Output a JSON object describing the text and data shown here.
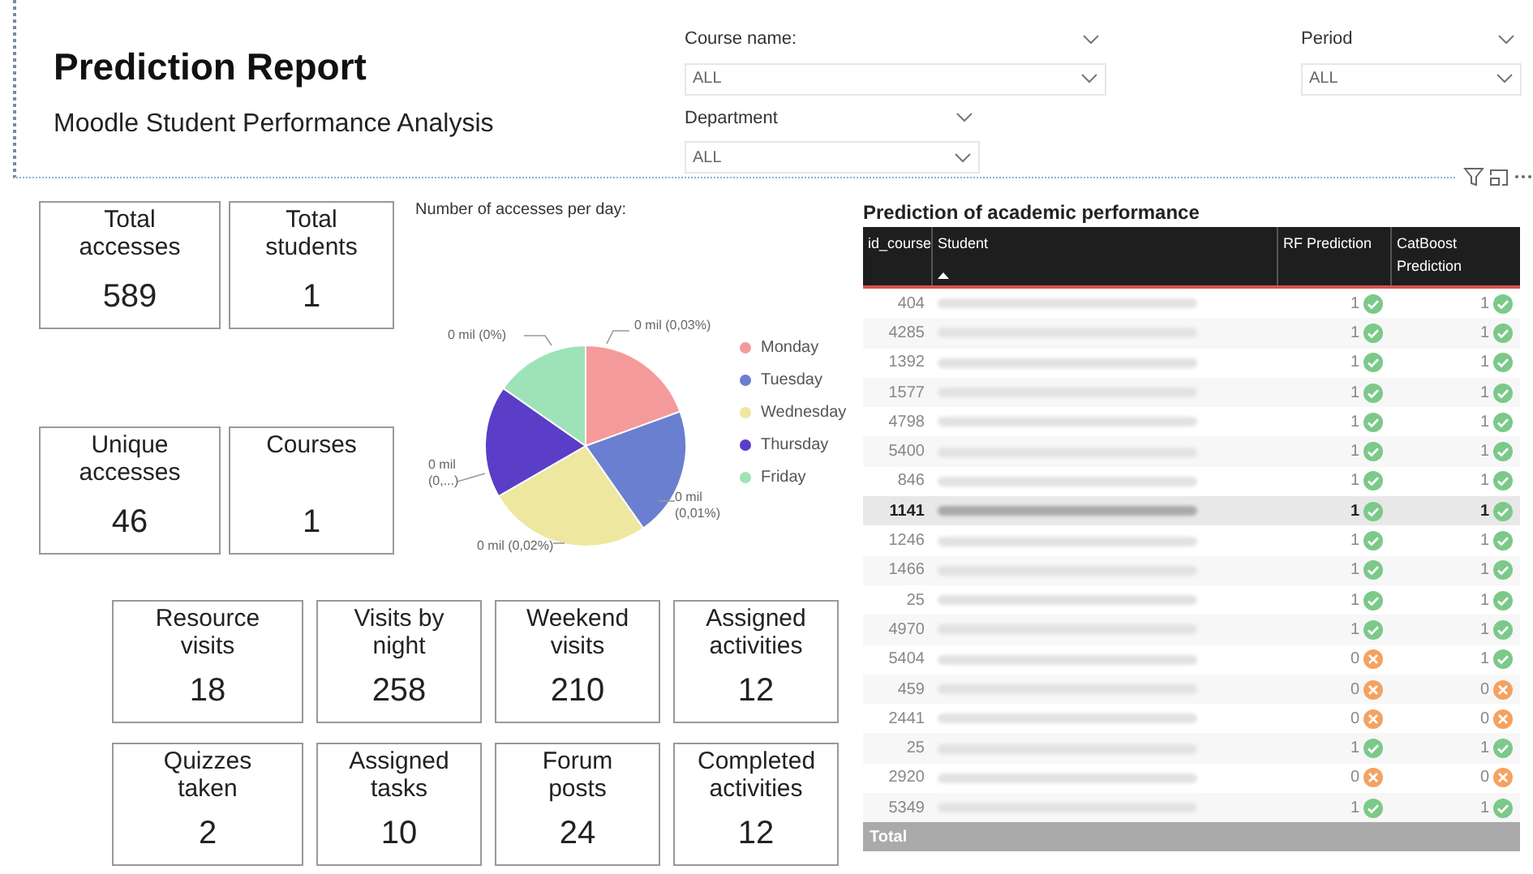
{
  "header": {
    "title": "Prediction Report",
    "subtitle": "Moodle Student Performance Analysis"
  },
  "filters": [
    {
      "label": "Course name:",
      "value": "ALL"
    },
    {
      "label": "Department",
      "value": "ALL"
    },
    {
      "label": "Period",
      "value": "ALL"
    }
  ],
  "kpis_top": [
    {
      "label": "Total accesses",
      "value": "589"
    },
    {
      "label": "Total students",
      "value": "1"
    },
    {
      "label": "Unique accesses",
      "value": "46"
    },
    {
      "label": "Courses",
      "value": "1"
    }
  ],
  "pie": {
    "title": "Number of accesses per day:",
    "legend": [
      {
        "label": "Monday",
        "color": "#f59a9a"
      },
      {
        "label": "Tuesday",
        "color": "#6b7fd0"
      },
      {
        "label": "Wednesday",
        "color": "#ede7a0"
      },
      {
        "label": "Thursday",
        "color": "#5a3ec8"
      },
      {
        "label": "Friday",
        "color": "#9ee3b8"
      }
    ],
    "slice_labels": [
      "0 mil (0,03%)",
      "0 mil (0,01%)",
      "0 mil (0,02%)",
      "0 mil (0,...)",
      "0 mil (0%)"
    ]
  },
  "kpis_bottom": [
    {
      "label": "Resource visits",
      "value": "18"
    },
    {
      "label": "Visits by night",
      "value": "258"
    },
    {
      "label": "Weekend visits",
      "value": "210"
    },
    {
      "label": "Assigned activities",
      "value": "12"
    },
    {
      "label": "Quizzes taken",
      "value": "2"
    },
    {
      "label": "Assigned tasks",
      "value": "10"
    },
    {
      "label": "Forum posts",
      "value": "24"
    },
    {
      "label": "Completed activities",
      "value": "12"
    }
  ],
  "table": {
    "title": "Prediction of academic performance",
    "columns": [
      "id_course",
      "Student",
      "RF Prediction",
      "CatBoost Prediction"
    ],
    "rows": [
      {
        "id": "404",
        "rf": "1",
        "rf_ok": true,
        "cat": "1",
        "cat_ok": true,
        "selected": false
      },
      {
        "id": "4285",
        "rf": "1",
        "rf_ok": true,
        "cat": "1",
        "cat_ok": true,
        "selected": false
      },
      {
        "id": "1392",
        "rf": "1",
        "rf_ok": true,
        "cat": "1",
        "cat_ok": true,
        "selected": false
      },
      {
        "id": "1577",
        "rf": "1",
        "rf_ok": true,
        "cat": "1",
        "cat_ok": true,
        "selected": false
      },
      {
        "id": "4798",
        "rf": "1",
        "rf_ok": true,
        "cat": "1",
        "cat_ok": true,
        "selected": false
      },
      {
        "id": "5400",
        "rf": "1",
        "rf_ok": true,
        "cat": "1",
        "cat_ok": true,
        "selected": false
      },
      {
        "id": "846",
        "rf": "1",
        "rf_ok": true,
        "cat": "1",
        "cat_ok": true,
        "selected": false
      },
      {
        "id": "1141",
        "rf": "1",
        "rf_ok": true,
        "cat": "1",
        "cat_ok": true,
        "selected": true
      },
      {
        "id": "1246",
        "rf": "1",
        "rf_ok": true,
        "cat": "1",
        "cat_ok": true,
        "selected": false
      },
      {
        "id": "1466",
        "rf": "1",
        "rf_ok": true,
        "cat": "1",
        "cat_ok": true,
        "selected": false
      },
      {
        "id": "25",
        "rf": "1",
        "rf_ok": true,
        "cat": "1",
        "cat_ok": true,
        "selected": false
      },
      {
        "id": "4970",
        "rf": "1",
        "rf_ok": true,
        "cat": "1",
        "cat_ok": true,
        "selected": false
      },
      {
        "id": "5404",
        "rf": "0",
        "rf_ok": false,
        "cat": "1",
        "cat_ok": true,
        "selected": false
      },
      {
        "id": "459",
        "rf": "0",
        "rf_ok": false,
        "cat": "0",
        "cat_ok": false,
        "selected": false
      },
      {
        "id": "2441",
        "rf": "0",
        "rf_ok": false,
        "cat": "0",
        "cat_ok": false,
        "selected": false
      },
      {
        "id": "25",
        "rf": "1",
        "rf_ok": true,
        "cat": "1",
        "cat_ok": true,
        "selected": false
      },
      {
        "id": "2920",
        "rf": "0",
        "rf_ok": false,
        "cat": "0",
        "cat_ok": false,
        "selected": false
      },
      {
        "id": "5349",
        "rf": "1",
        "rf_ok": true,
        "cat": "1",
        "cat_ok": true,
        "selected": false
      }
    ],
    "total_label": "Total"
  }
}
